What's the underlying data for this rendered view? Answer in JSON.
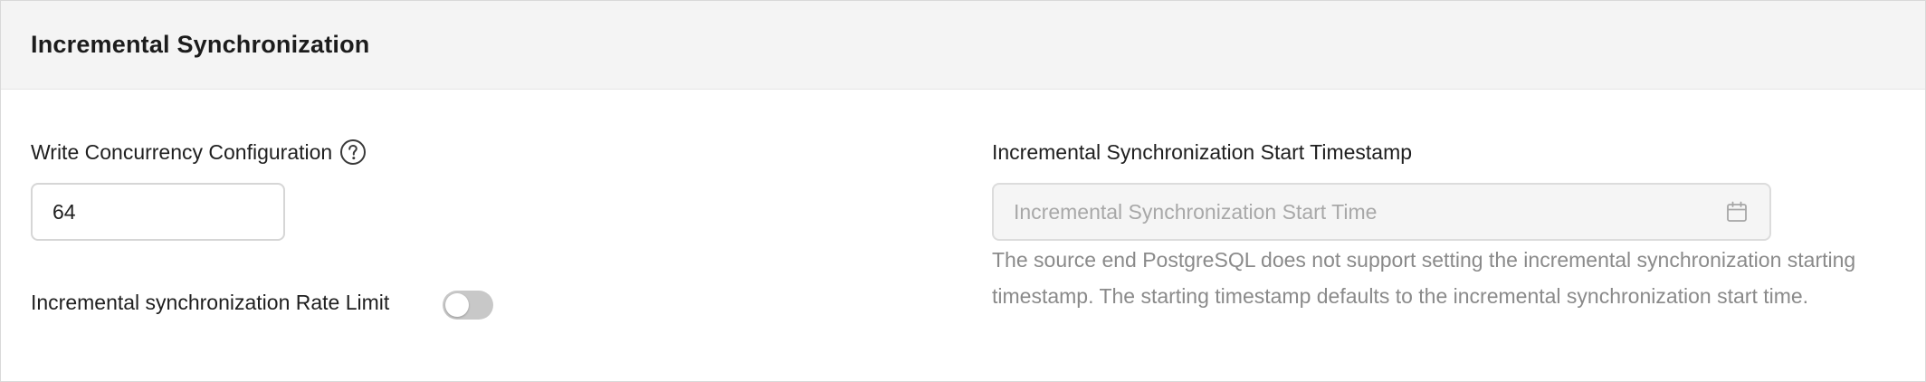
{
  "section": {
    "title": "Incremental Synchronization"
  },
  "write_concurrency": {
    "label": "Write Concurrency Configuration",
    "value": "64",
    "help_icon": "question-circle-icon"
  },
  "rate_limit": {
    "label": "Incremental synchronization Rate Limit",
    "enabled": false
  },
  "start_timestamp": {
    "label": "Incremental Synchronization Start Timestamp",
    "placeholder": "Incremental Synchronization Start Time",
    "icon": "calendar-icon",
    "disabled": true,
    "help_text": "The source end PostgreSQL does not support setting the incremental synchronization starting timestamp. The starting timestamp defaults to the incremental synchronization start time."
  },
  "colors": {
    "header_bg": "#f4f4f4",
    "toggle_off": "#c8c8c8",
    "disabled_input_bg": "#f5f5f5",
    "help_text": "#8a8a8a"
  }
}
